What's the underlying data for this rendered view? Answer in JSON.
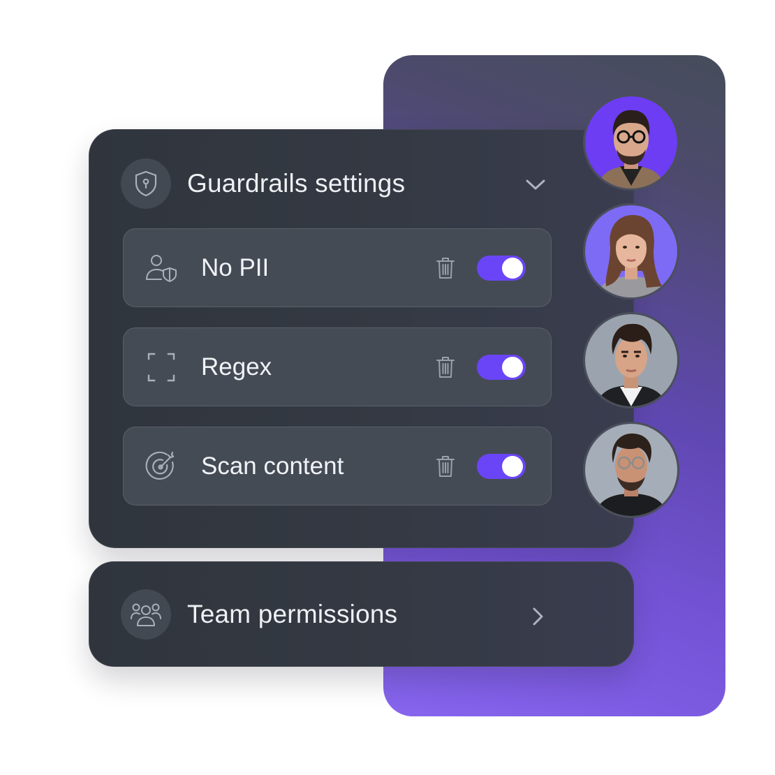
{
  "guardrails": {
    "title": "Guardrails settings",
    "header_icon": "shield-lock-icon",
    "expand_icon": "chevron-down-icon",
    "items": [
      {
        "label": "No PII",
        "icon": "user-shield-icon",
        "enabled": true
      },
      {
        "label": "Regex",
        "icon": "frame-corners-icon",
        "enabled": true
      },
      {
        "label": "Scan content",
        "icon": "target-icon",
        "enabled": true
      }
    ]
  },
  "team": {
    "title": "Team permissions",
    "icon": "users-group-icon",
    "open_icon": "chevron-right-icon"
  },
  "colors": {
    "accent": "#6a45f7",
    "card": "#343943",
    "row": "#454b55",
    "panel_gradient_end": "#8765ee"
  }
}
